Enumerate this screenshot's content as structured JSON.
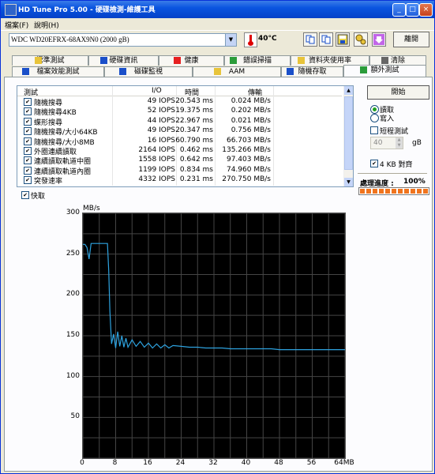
{
  "window": {
    "title": "HD Tune Pro  5.00 - 硬碟檢測-維護工具",
    "minimize": "_",
    "maximize": "□",
    "close": "×"
  },
  "menu": [
    "檔案(F)",
    "說明(H)"
  ],
  "toolbar": {
    "drive": "WDC WD20EFRX-68AX9N0 (2000 gB)",
    "temperature": "40°C",
    "exit_label": "離開",
    "tool_icons": [
      "copy-icon",
      "copy-icon",
      "save-icon",
      "options-icon",
      "download-icon"
    ],
    "accent_colors": {
      "save": "#e8d44a",
      "options": "#e8c43a",
      "download": "#c266e8"
    }
  },
  "tabs_top": [
    {
      "label": "標準測試",
      "icon": "benchmark-icon",
      "icon_color": "#e8c43a"
    },
    {
      "label": "硬碟資訊",
      "icon": "info-icon",
      "icon_color": "#1a4fc9"
    },
    {
      "label": "健康",
      "icon": "health-cross-icon",
      "icon_color": "#e62020"
    },
    {
      "label": "錯誤掃描",
      "icon": "scan-icon",
      "icon_color": "#2b9c3a"
    },
    {
      "label": "資料夾使用率",
      "icon": "folder-icon",
      "icon_color": "#e8c43a"
    },
    {
      "label": "清除",
      "icon": "erase-icon",
      "icon_color": "#666666"
    }
  ],
  "tabs_bottom": [
    {
      "label": "檔案效能測試",
      "icon": "file-benchmark-icon",
      "icon_color": "#1a4fc9"
    },
    {
      "label": "磁碟監視",
      "icon": "monitor-icon",
      "icon_color": "#1a4fc9"
    },
    {
      "label": "AAM",
      "icon": "speaker-icon",
      "icon_color": "#e8c43a"
    },
    {
      "label": "隨機存取",
      "icon": "random-access-icon",
      "icon_color": "#1a4fc9"
    },
    {
      "label": "額外測試",
      "icon": "extra-tests-icon",
      "icon_color": "#2b9c3a",
      "active": true
    }
  ],
  "results": {
    "headers": {
      "test": "測試",
      "io": "I/O",
      "time": "時間",
      "transfer": "傳輸"
    },
    "rows": [
      {
        "test": "隨機搜尋",
        "io": "49 IOPS",
        "time": "20.543 ms",
        "transfer": "0.024 MB/s",
        "checked": true
      },
      {
        "test": "隨機搜尋4KB",
        "io": "52 IOPS",
        "time": "19.375 ms",
        "transfer": "0.202 MB/s",
        "checked": true
      },
      {
        "test": "蝶形搜尋",
        "io": "44 IOPS",
        "time": "22.967 ms",
        "transfer": "0.021 MB/s",
        "checked": true
      },
      {
        "test": "隨機搜尋/大小64KB",
        "io": "49 IOPS",
        "time": "20.347 ms",
        "transfer": "0.756 MB/s",
        "checked": true
      },
      {
        "test": "隨機搜尋/大小8MB",
        "io": "16 IOPS",
        "time": "60.790 ms",
        "transfer": "66.703 MB/s",
        "checked": true
      },
      {
        "test": "外圈連續讀取",
        "io": "2164 IOPS",
        "time": "0.462 ms",
        "transfer": "135.266 MB/s",
        "checked": true
      },
      {
        "test": "連續讀取軌道中圈",
        "io": "1558 IOPS",
        "time": "0.642 ms",
        "transfer": "97.403 MB/s",
        "checked": true
      },
      {
        "test": "連續讀取軌道內圈",
        "io": "1199 IOPS",
        "time": "0.834 ms",
        "transfer": "74.960 MB/s",
        "checked": true
      },
      {
        "test": "突發速率",
        "io": "4332 IOPS",
        "time": "0.231 ms",
        "transfer": "270.750 MB/s",
        "checked": true
      }
    ]
  },
  "side": {
    "start_label": "開始",
    "read_label": "讀取",
    "write_label": "寫入",
    "mode": "read",
    "short_test_label": "短程測試",
    "short_test_checked": false,
    "size_value": "40",
    "size_unit": "gB",
    "align4k_label": "4 KB 對齊",
    "align4k_checked": true,
    "progress_label": "處理進度 :",
    "progress_value": "100%",
    "progress_fraction": 1.0,
    "progress_color": "#f0741e"
  },
  "quick": {
    "label": "快取",
    "checked": true
  },
  "chart_data": {
    "type": "line",
    "ylabel": "MB/s",
    "ylim": [
      0,
      300
    ],
    "yticks": [
      50,
      100,
      150,
      200,
      250,
      300
    ],
    "xlim": [
      0,
      64
    ],
    "xticks": [
      {
        "v": 0,
        "label": "0"
      },
      {
        "v": 8,
        "label": "8"
      },
      {
        "v": 16,
        "label": "16"
      },
      {
        "v": 24,
        "label": "24"
      },
      {
        "v": 32,
        "label": "32"
      },
      {
        "v": 40,
        "label": "40"
      },
      {
        "v": 48,
        "label": "48"
      },
      {
        "v": 56,
        "label": "56"
      },
      {
        "v": 64,
        "label": "64MB"
      }
    ],
    "line_color": "#2ea3e0",
    "background": "#000000",
    "grid_color": "#454545",
    "series": [
      {
        "x": [
          0,
          0.5,
          1,
          1.5,
          2,
          2.5,
          3,
          3.5,
          4,
          4.5,
          5,
          5.5,
          6,
          6.3,
          6.6,
          7,
          7.5,
          8,
          8.5,
          9,
          9.5,
          10,
          10.5,
          11,
          12,
          13,
          14,
          15,
          16,
          17,
          18,
          19,
          20,
          21,
          22,
          24,
          26,
          28,
          30,
          32,
          34,
          36,
          38,
          40,
          42,
          44,
          46,
          48,
          50,
          52,
          54,
          56,
          58,
          60,
          62,
          64
        ],
        "y": [
          262,
          262,
          258,
          244,
          263,
          263,
          263,
          263,
          263,
          263,
          263,
          263,
          263,
          230,
          180,
          140,
          152,
          135,
          155,
          137,
          150,
          136,
          147,
          136,
          145,
          137,
          143,
          136,
          141,
          135,
          140,
          135,
          139,
          135,
          138,
          137,
          136,
          136,
          135,
          135,
          135,
          134,
          134,
          134,
          134,
          134,
          134,
          133,
          133,
          133,
          133,
          133,
          133,
          133,
          133,
          133
        ]
      }
    ]
  }
}
